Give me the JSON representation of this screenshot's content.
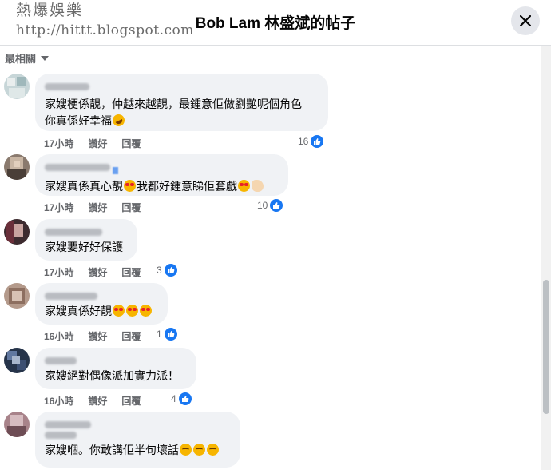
{
  "watermark": {
    "title": "熱爆娛樂",
    "url": "http://hittt.blogspot.com"
  },
  "header": {
    "title": "Bob Lam 林盛斌的帖子"
  },
  "sort": {
    "label": "最相關"
  },
  "colors": {
    "accent": "#1877f2",
    "bubble": "#f0f2f5",
    "meta": "#65676b"
  },
  "actions": {
    "like": "讚好",
    "reply": "回覆"
  },
  "comments": [
    {
      "lines": [
        "家嫂梗係靚，仲越來越靚，最鍾意佢做劉艷呢個角色",
        "你真係好幸福"
      ],
      "time": "17小時",
      "reactions": "16"
    },
    {
      "lines": [
        "家嫂真係真心靚",
        "我都好鍾意睇佢套戲"
      ],
      "time": "17小時",
      "reactions": "10"
    },
    {
      "lines": [
        "家嫂要好好保護"
      ],
      "time": "17小時",
      "reactions": "3"
    },
    {
      "lines": [
        "家嫂真係好靚"
      ],
      "time": "16小時",
      "reactions": "1"
    },
    {
      "lines": [
        "家嫂絕對偶像派加實力派！"
      ],
      "time": "16小時",
      "reactions": "4"
    },
    {
      "lines": [
        "家嫂嗰。你敢講佢半句壞話"
      ]
    }
  ]
}
